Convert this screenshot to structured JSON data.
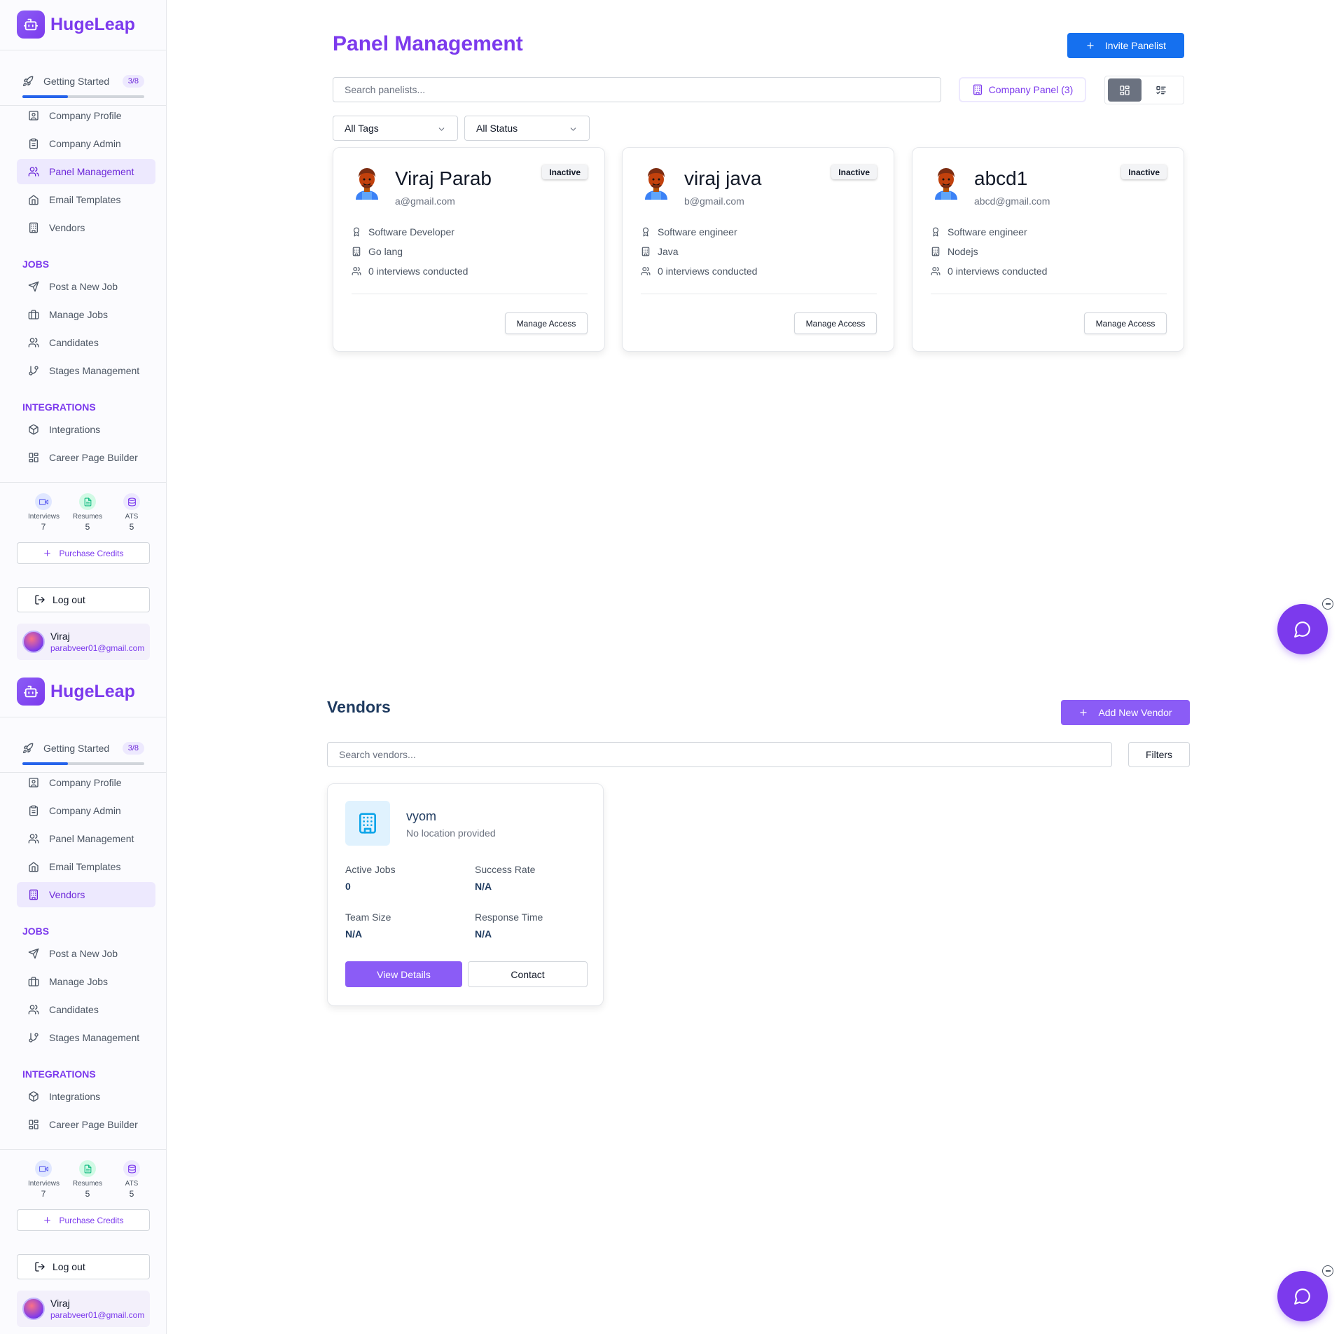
{
  "brand": {
    "name": "HugeLeap"
  },
  "sidebar": {
    "getting_started": {
      "label": "Getting Started",
      "badge": "3/8",
      "progress": 0.375
    },
    "items": [
      {
        "label": "Company Profile",
        "icon": "user-square-icon"
      },
      {
        "label": "Company Admin",
        "icon": "clipboard-icon"
      },
      {
        "label": "Panel Management",
        "icon": "users-icon"
      },
      {
        "label": "Email Templates",
        "icon": "home-icon"
      },
      {
        "label": "Vendors",
        "icon": "building-icon"
      }
    ],
    "jobs_title": "JOBS",
    "jobs": [
      {
        "label": "Post a New Job",
        "icon": "send-icon"
      },
      {
        "label": "Manage Jobs",
        "icon": "briefcase-icon"
      },
      {
        "label": "Candidates",
        "icon": "users-icon"
      },
      {
        "label": "Stages Management",
        "icon": "git-branch-icon"
      }
    ],
    "integrations_title": "INTEGRATIONS",
    "integrations": [
      {
        "label": "Integrations",
        "icon": "box-icon"
      },
      {
        "label": "Career Page Builder",
        "icon": "layout-grid-icon"
      }
    ],
    "credits": [
      {
        "label": "Interviews",
        "value": "7",
        "color": "#6366f1",
        "bg": "#e0e7ff"
      },
      {
        "label": "Resumes",
        "value": "5",
        "color": "#10b981",
        "bg": "#d1fae5"
      },
      {
        "label": "ATS",
        "value": "5",
        "color": "#7c3aed",
        "bg": "#ede9fe"
      }
    ],
    "purchase_label": "Purchase Credits",
    "logout_label": "Log out",
    "user": {
      "name": "Viraj",
      "email": "parabveer01@gmail.com"
    }
  },
  "panel": {
    "title": "Panel Management",
    "invite_label": "Invite Panelist",
    "search_placeholder": "Search panelists...",
    "company_panel_label": "Company Panel (3)",
    "tags_filter": "All Tags",
    "status_filter": "All Status",
    "cards": [
      {
        "name": "Viraj Parab",
        "email": "a@gmail.com",
        "status": "Inactive",
        "role": "Software Developer",
        "skill": "Go lang",
        "interviews": "0 interviews conducted",
        "action": "Manage Access"
      },
      {
        "name": "viraj java",
        "email": "b@gmail.com",
        "status": "Inactive",
        "role": "Software engineer",
        "skill": "Java",
        "interviews": "0 interviews conducted",
        "action": "Manage Access"
      },
      {
        "name": "abcd1",
        "email": "abcd@gmail.com",
        "status": "Inactive",
        "role": "Software engineer",
        "skill": "Nodejs",
        "interviews": "0 interviews conducted",
        "action": "Manage Access"
      }
    ]
  },
  "vendors": {
    "title": "Vendors",
    "add_label": "Add New Vendor",
    "search_placeholder": "Search vendors...",
    "filters_label": "Filters",
    "card": {
      "name": "vyom",
      "location": "No location provided",
      "active_jobs_label": "Active Jobs",
      "active_jobs": "0",
      "success_rate_label": "Success Rate",
      "success_rate": "N/A",
      "team_size_label": "Team Size",
      "team_size": "N/A",
      "response_time_label": "Response Time",
      "response_time": "N/A",
      "view_label": "View Details",
      "contact_label": "Contact"
    }
  },
  "colors": {
    "brand": "#7c3aed",
    "primary_blue": "#1570ef",
    "vendor_purple": "#8b5cf6"
  }
}
